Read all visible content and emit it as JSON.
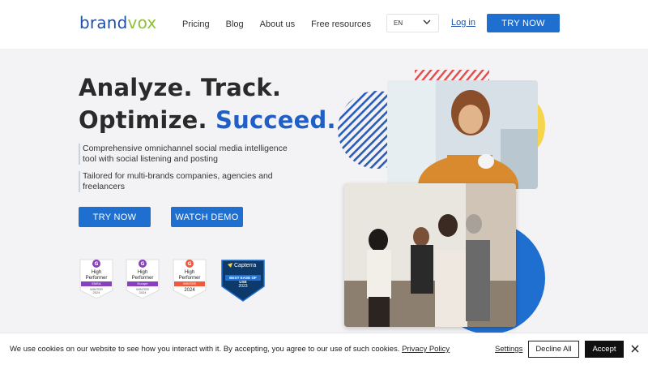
{
  "header": {
    "logo_part1": "brand",
    "logo_part2": "vox",
    "nav": [
      "Pricing",
      "Blog",
      "About us",
      "Free resources"
    ],
    "language": "EN",
    "login": "Log in",
    "try_now": "TRY NOW"
  },
  "hero": {
    "headline_line1": "Analyze. Track.",
    "headline_line2a": "Optimize.",
    "headline_line2b": "Succeed.",
    "bullet1": "Comprehensive omnichannel social media intelligence tool with social listening and posting",
    "bullet2": "Tailored for multi-brands companies, agencies and freelancers",
    "try_now": "TRY NOW",
    "watch_demo": "WATCH DEMO"
  },
  "badges": [
    {
      "line1": "High",
      "line2": "Performer",
      "strip": "EMEA",
      "season": "WINTER",
      "year": "2024",
      "strip_color": "#8a3fbf"
    },
    {
      "line1": "High",
      "line2": "Performer",
      "strip": "Europe",
      "season": "WINTER",
      "year": "2024",
      "strip_color": "#8a3fbf"
    },
    {
      "line1": "High",
      "line2": "Performer",
      "strip": "WINTER",
      "season": "",
      "year": "2024",
      "strip_color": "#f05a3c"
    }
  ],
  "capterra": {
    "brand": "Capterra",
    "line1": "BEST EASE OF USE",
    "year": "2023"
  },
  "cookie": {
    "text": "We use cookies on our website to see how you interact with it. By accepting, you agree to our use of such cookies.",
    "privacy": "Privacy Policy",
    "settings": "Settings",
    "decline": "Decline All",
    "accept": "Accept"
  },
  "colors": {
    "primary_blue": "#1f6fd1",
    "headline_blue": "#1f5fc6",
    "logo_green": "#8fbf3f",
    "accent_yellow": "#f6d44c",
    "accent_red": "#e34a4a"
  },
  "icons": [
    "chevron-down-icon",
    "close-icon",
    "g2-logo-icon",
    "capterra-logo-icon"
  ]
}
